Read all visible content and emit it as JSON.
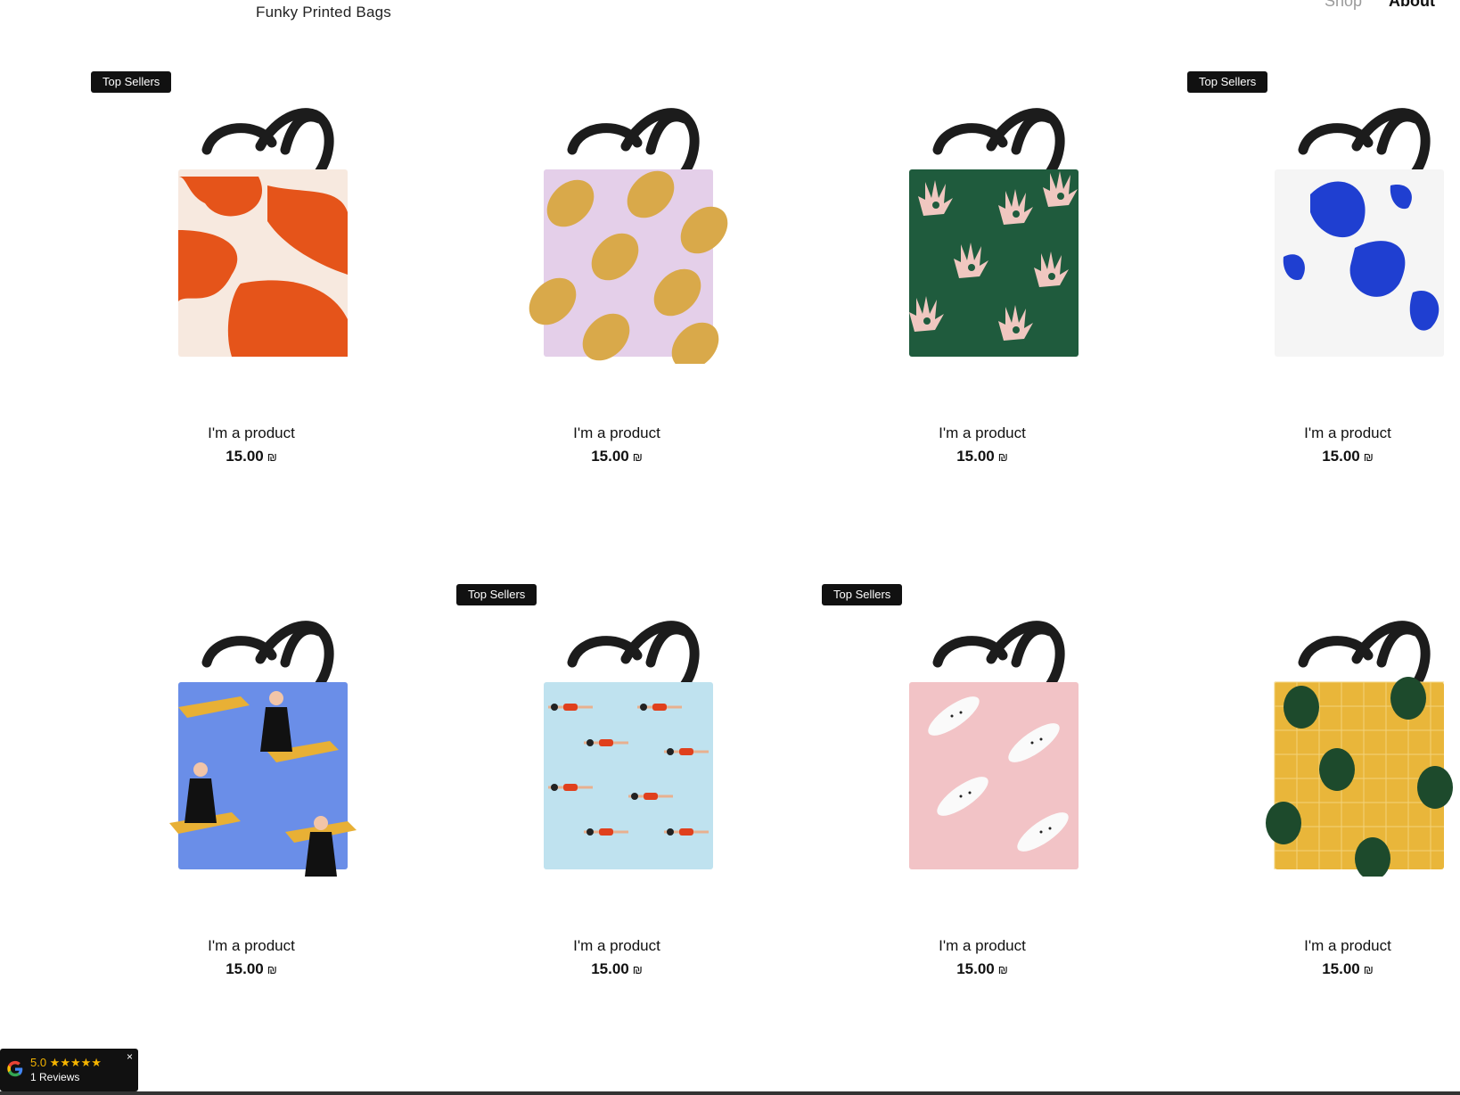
{
  "header": {
    "title": "Funky Printed Bags",
    "nav": [
      "Shop",
      "About"
    ]
  },
  "products": [
    {
      "name": "I'm a product",
      "price": "15.00",
      "currency": "₪",
      "badge": "Top Sellers",
      "pattern": "orange-strokes"
    },
    {
      "name": "I'm a product",
      "price": "15.00",
      "currency": "₪",
      "badge": "",
      "pattern": "lemons"
    },
    {
      "name": "I'm a product",
      "price": "15.00",
      "currency": "₪",
      "badge": "",
      "pattern": "hands-green"
    },
    {
      "name": "I'm a product",
      "price": "15.00",
      "currency": "₪",
      "badge": "Top Sellers",
      "pattern": "blue-blobs"
    },
    {
      "name": "I'm a product",
      "price": "15.00",
      "currency": "₪",
      "badge": "",
      "pattern": "women-tigers"
    },
    {
      "name": "I'm a product",
      "price": "15.00",
      "currency": "₪",
      "badge": "Top Sellers",
      "pattern": "swimmers"
    },
    {
      "name": "I'm a product",
      "price": "15.00",
      "currency": "₪",
      "badge": "Top Sellers",
      "pattern": "leopards-pink"
    },
    {
      "name": "I'm a product",
      "price": "15.00",
      "currency": "₪",
      "badge": "",
      "pattern": "monstera-yellow"
    }
  ],
  "review_widget": {
    "score": "5.0 ★★★★★",
    "count": "1 Reviews",
    "close": "×",
    "icon": "google-icon"
  },
  "colors": {
    "badge": "#111111",
    "text": "#111111",
    "star": "#f5b400"
  }
}
